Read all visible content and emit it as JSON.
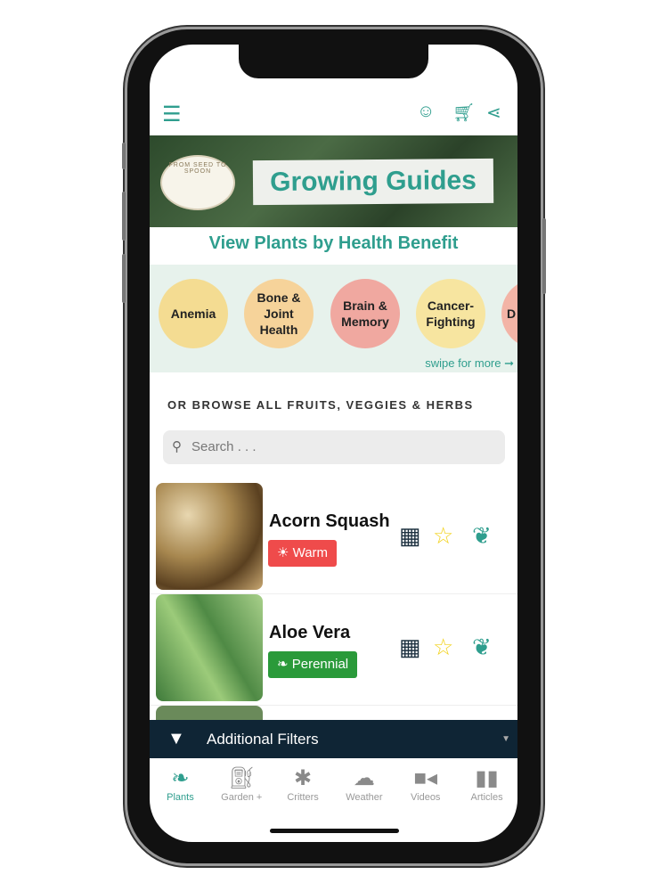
{
  "header": {
    "menu_icon": "hamburger-icon",
    "icons": [
      "smiley-icon",
      "cart-icon",
      "share-icon"
    ]
  },
  "banner": {
    "title": "Growing Guides",
    "logo_text": "FROM SEED TO SPOON"
  },
  "health": {
    "title": "View Plants by Health Benefit",
    "items": [
      "Anemia",
      "Bone & Joint Health",
      "Brain & Memory",
      "Cancer-Fighting",
      "D"
    ],
    "swipe": "swipe for more ➞"
  },
  "browse": {
    "label": "OR BROWSE ALL FRUITS, VEGGIES & HERBS",
    "search_placeholder": "Search . . ."
  },
  "plants": [
    {
      "name": "Acorn Squash",
      "badge": "☀ Warm",
      "badge_color": "#ef4b4b"
    },
    {
      "name": "Aloe Vera",
      "badge": "❧ Perennial",
      "badge_color": "#2a9a3a"
    }
  ],
  "filters": {
    "label": "Additional Filters"
  },
  "tabs": [
    {
      "label": "Plants",
      "active": true
    },
    {
      "label": "Garden +"
    },
    {
      "label": "Critters"
    },
    {
      "label": "Weather"
    },
    {
      "label": "Videos"
    },
    {
      "label": "Articles"
    }
  ],
  "colors": {
    "accent": "#2f9e8e",
    "filter_bar": "#0f2535"
  }
}
